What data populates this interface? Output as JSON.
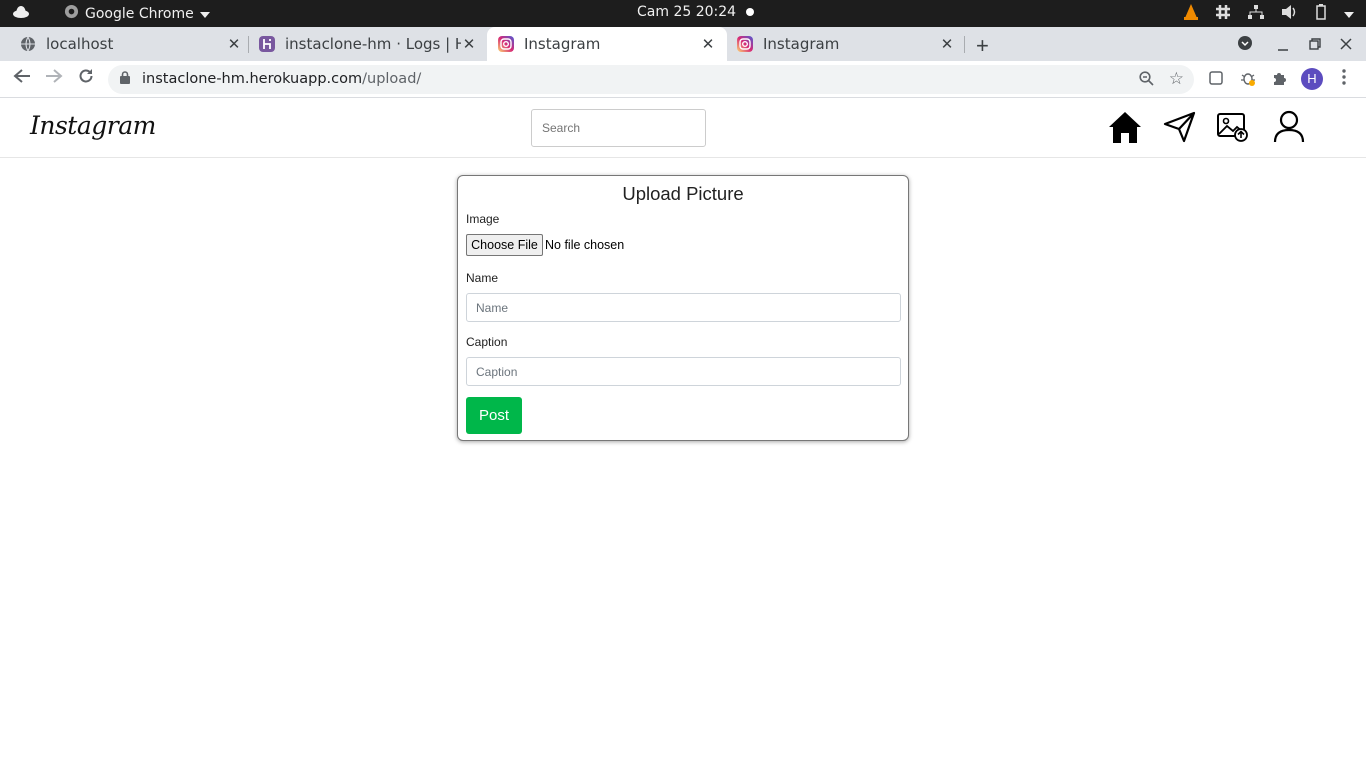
{
  "system_bar": {
    "app_name": "Google Chrome",
    "clock": "Cam 25  20:24"
  },
  "browser": {
    "tabs": [
      {
        "title": "localhost",
        "favicon": "globe-icon",
        "active": false
      },
      {
        "title": "instaclone-hm · Logs | Her",
        "favicon": "heroku-icon",
        "active": false
      },
      {
        "title": "Instagram",
        "favicon": "instagram-icon",
        "active": true
      },
      {
        "title": "Instagram",
        "favicon": "instagram-icon",
        "active": false
      }
    ],
    "url_host": "instaclone-hm.herokuapp.com",
    "url_path": "/upload/",
    "profile_initial": "H"
  },
  "site": {
    "logo": "Instagram",
    "search_placeholder": "Search",
    "nav_icons": [
      "home-icon",
      "send-icon",
      "upload-image-icon",
      "profile-icon"
    ]
  },
  "upload_form": {
    "title": "Upload Picture",
    "image_label": "Image",
    "choose_file_label": "Choose File",
    "no_file_text": "No file chosen",
    "name_label": "Name",
    "name_placeholder": "Name",
    "caption_label": "Caption",
    "caption_placeholder": "Caption",
    "post_label": "Post"
  },
  "colors": {
    "post_button": "#00b74a",
    "profile_avatar": "#5c4cbf",
    "heroku_purple": "#79589f"
  }
}
